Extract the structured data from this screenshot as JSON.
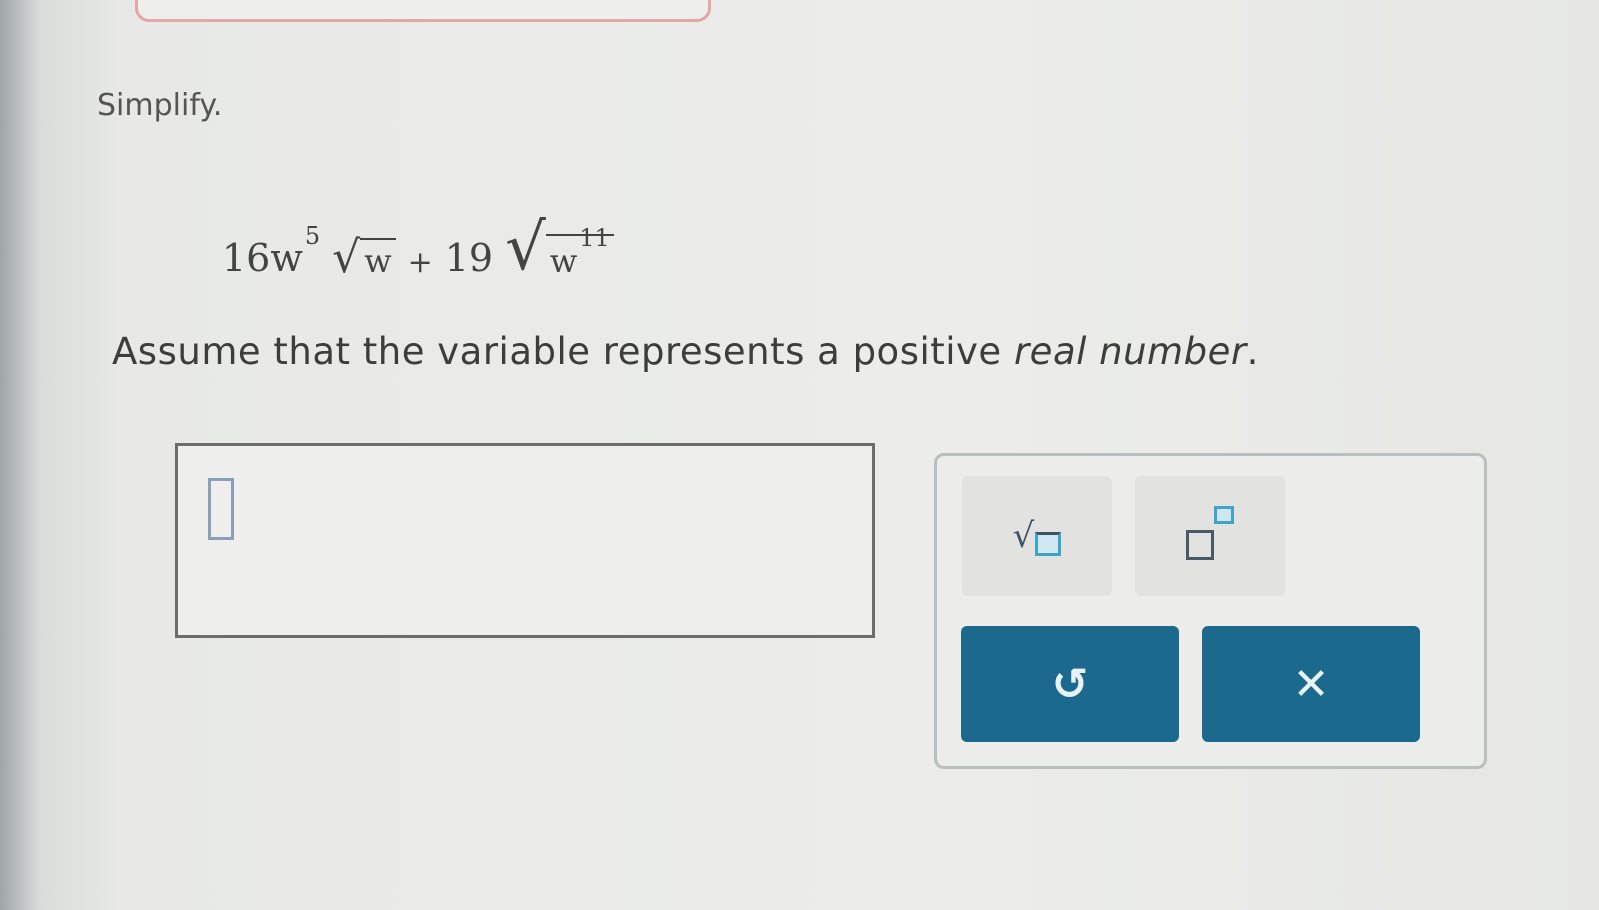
{
  "instruction": "Simplify.",
  "expression": {
    "term1_coef": "16w",
    "term1_exp": "5",
    "term1_radicand": "w",
    "operator": "+",
    "term2_coef": "19",
    "term2_radicand": "w",
    "term2_exp": "11"
  },
  "assumption": {
    "prefix": "Assume that the variable represents a positive ",
    "emphasis": "real number",
    "suffix": "."
  },
  "toolbar": {
    "sqrt_symbol": "√",
    "undo_symbol": "↺",
    "clear_symbol": "✕"
  },
  "colors": {
    "action_button": "#1b6a8d",
    "placeholder_accent": "#3fa5c8"
  }
}
